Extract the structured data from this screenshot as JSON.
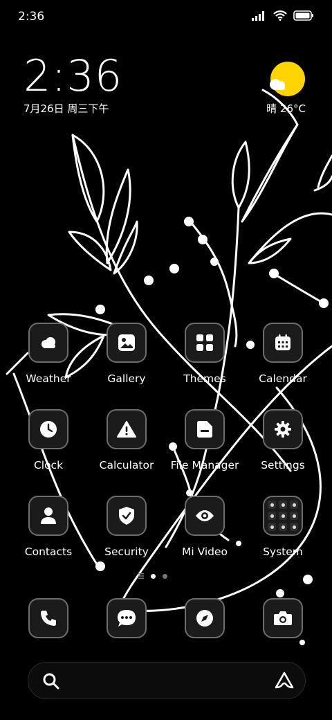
{
  "status_bar": {
    "time": "2:36",
    "icons": [
      "signal-icon",
      "wifi-icon",
      "battery-icon"
    ]
  },
  "clock_widget": {
    "time": "2:36",
    "date": "7月26日 周三下午"
  },
  "weather_widget": {
    "text": "晴 26°C",
    "icon": "sun-cloud-icon",
    "sun_color": "#FFD400"
  },
  "apps": [
    {
      "label": "Weather",
      "icon": "cloud-icon"
    },
    {
      "label": "Gallery",
      "icon": "image-icon"
    },
    {
      "label": "Themes",
      "icon": "grid-icon"
    },
    {
      "label": "Calendar",
      "icon": "calendar-icon"
    },
    {
      "label": "Clock",
      "icon": "clock-icon"
    },
    {
      "label": "Calculator",
      "icon": "warning-icon"
    },
    {
      "label": "File Manager",
      "icon": "folder-icon"
    },
    {
      "label": "Settings",
      "icon": "gear-icon"
    },
    {
      "label": "Contacts",
      "icon": "person-icon"
    },
    {
      "label": "Security",
      "icon": "shield-check-icon"
    },
    {
      "label": "Mi Video",
      "icon": "eye-icon"
    },
    {
      "label": "System",
      "icon": "folder-grid-icon"
    }
  ],
  "page_indicator": {
    "pages": 2,
    "current": 1
  },
  "dock": [
    {
      "icon": "phone-icon"
    },
    {
      "icon": "message-icon"
    },
    {
      "icon": "compass-icon"
    },
    {
      "icon": "camera-icon"
    }
  ],
  "search_bar": {
    "search_icon": "search-icon",
    "assistant_icon": "assistant-icon"
  },
  "colors": {
    "background": "#000000",
    "tile_border": "#6d6d6d",
    "tile_bg": "#1b1b1b",
    "accent_sun": "#FFD400"
  }
}
